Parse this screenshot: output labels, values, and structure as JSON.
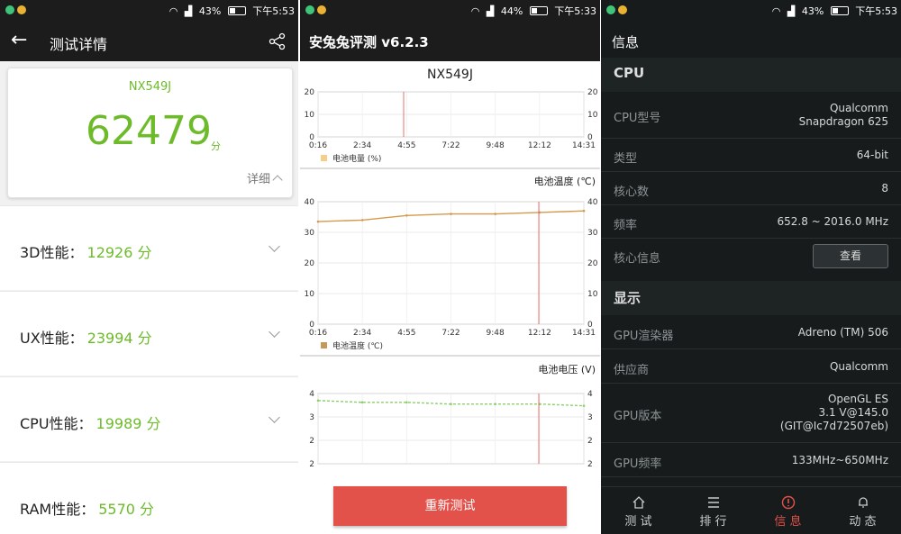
{
  "panel1": {
    "status": {
      "battery": "43%",
      "time": "下午5:53"
    },
    "title": "测试详情",
    "model": "NX549J",
    "score": "62479",
    "score_unit": "分",
    "detail_label": "详细",
    "categories": [
      {
        "label": "3D性能：",
        "value": "12926 分"
      },
      {
        "label": "UX性能：",
        "value": "23994 分"
      },
      {
        "label": "CPU性能：",
        "value": "19989 分"
      },
      {
        "label": "RAM性能：",
        "value": "5570 分"
      }
    ]
  },
  "panel2": {
    "status": {
      "battery": "44%",
      "time": "下午5:33"
    },
    "title": "安兔兔评测 v6.2.3",
    "model": "NX549J",
    "x_ticks": [
      "0:16",
      "2:34",
      "4:55",
      "7:22",
      "9:48",
      "12:12",
      "14:31"
    ],
    "charts": [
      {
        "legend": "电池电量 (%)",
        "y_ticks": [
          "20",
          "10",
          "0"
        ],
        "legend_color": "#f5cf8a"
      },
      {
        "title": "电池温度 (℃)",
        "legend": "电池温度 (℃)",
        "y_ticks": [
          "40",
          "30",
          "20",
          "10",
          "0"
        ],
        "legend_color": "#c39a5a"
      },
      {
        "title": "电池电压 (V)",
        "y_ticks": [
          "4",
          "3",
          "2",
          "2"
        ]
      }
    ],
    "retest_button": "重新测试"
  },
  "panel3": {
    "status": {
      "battery": "43%",
      "time": "下午5:53"
    },
    "title": "信息",
    "cpu_section": "CPU",
    "cpu_rows": [
      {
        "key": "CPU型号",
        "value": "Qualcomm\nSnapdragon 625"
      },
      {
        "key": "类型",
        "value": "64-bit"
      },
      {
        "key": "核心数",
        "value": "8"
      },
      {
        "key": "频率",
        "value": "652.8 ~ 2016.0 MHz"
      },
      {
        "key": "核心信息",
        "button": "查看"
      }
    ],
    "display_section": "显示",
    "display_rows": [
      {
        "key": "GPU渲染器",
        "value": "Adreno (TM) 506"
      },
      {
        "key": "供应商",
        "value": "Qualcomm"
      },
      {
        "key": "GPU版本",
        "value": "OpenGL ES\n3.1 V@145.0\n(GIT@Ic7d72507eb)"
      },
      {
        "key": "GPU频率",
        "value": "133MHz~650MHz"
      }
    ],
    "nav": [
      {
        "label": "测 试",
        "icon": "home-icon"
      },
      {
        "label": "排 行",
        "icon": "list-icon"
      },
      {
        "label": "信 息",
        "icon": "info-icon",
        "active": true
      },
      {
        "label": "动 态",
        "icon": "bell-icon"
      }
    ],
    "accent_color": "#e2514a"
  },
  "chart_data": [
    {
      "type": "line",
      "legend": [
        "电池电量 (%)"
      ],
      "x": [
        "0:16",
        "2:34",
        "4:55",
        "7:22",
        "9:48",
        "12:12",
        "14:31"
      ],
      "ylim": [
        0,
        20
      ],
      "y_ticks": [
        0,
        10,
        20
      ],
      "series": [
        {
          "name": "电池电量 (%)",
          "values": []
        }
      ]
    },
    {
      "type": "line",
      "title": "电池温度 (℃)",
      "legend": [
        "电池温度 (℃)"
      ],
      "x": [
        "0:16",
        "2:34",
        "4:55",
        "7:22",
        "9:48",
        "12:12",
        "14:31"
      ],
      "ylim": [
        0,
        40
      ],
      "y_ticks": [
        0,
        10,
        20,
        30,
        40
      ],
      "series": [
        {
          "name": "电池温度 (℃)",
          "values": [
            33.5,
            34,
            35.5,
            36,
            36,
            36.5,
            37
          ]
        }
      ]
    },
    {
      "type": "line",
      "title": "电池电压 (V)",
      "y_ticks": [
        2,
        2,
        3,
        4
      ],
      "series": [
        {
          "values": [
            3.8,
            3.75,
            3.75,
            3.7,
            3.7,
            3.7,
            3.65
          ]
        }
      ]
    }
  ]
}
